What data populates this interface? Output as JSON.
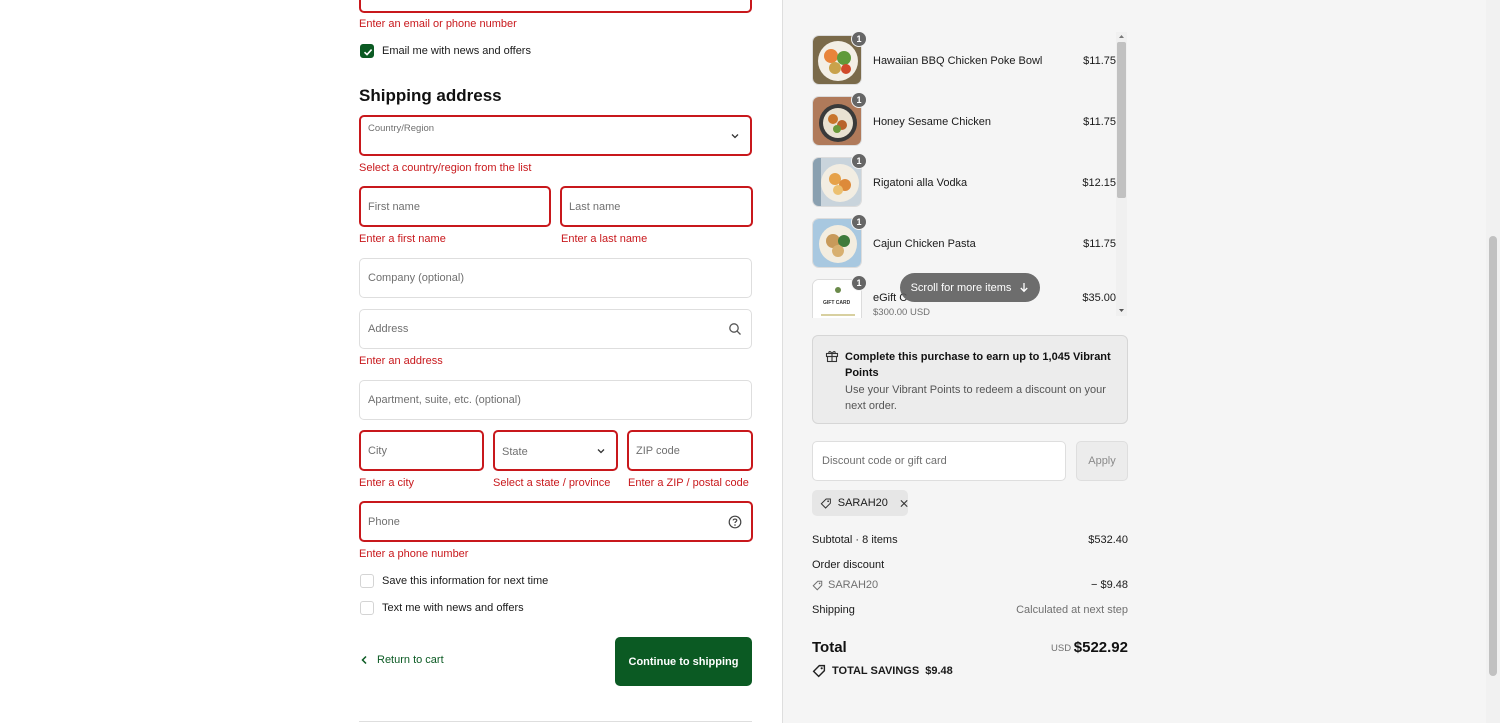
{
  "contact": {
    "email_error": "Enter an email or phone number",
    "email_news_label": "Email me with news and offers",
    "email_news_checked": true
  },
  "shipping": {
    "title": "Shipping address",
    "country_label": "Country/Region",
    "country_error": "Select a country/region from the list",
    "first_name_placeholder": "First name",
    "first_name_error": "Enter a first name",
    "last_name_placeholder": "Last name",
    "last_name_error": "Enter a last name",
    "company_placeholder": "Company (optional)",
    "address_placeholder": "Address",
    "address_error": "Enter an address",
    "apartment_placeholder": "Apartment, suite, etc. (optional)",
    "city_placeholder": "City",
    "city_error": "Enter a city",
    "state_placeholder": "State",
    "state_error": "Select a state / province",
    "zip_placeholder": "ZIP code",
    "zip_error": "Enter a ZIP / postal code",
    "phone_placeholder": "Phone",
    "phone_error": "Enter a phone number",
    "save_info_label": "Save this information for next time",
    "text_news_label": "Text me with news and offers"
  },
  "actions": {
    "return_label": "Return to cart",
    "continue_label": "Continue to shipping"
  },
  "cart": {
    "items": [
      {
        "name": "Hawaiian BBQ Chicken Poke Bowl",
        "price": "$11.75",
        "qty": "1"
      },
      {
        "name": "Honey Sesame Chicken",
        "price": "$11.75",
        "qty": "1"
      },
      {
        "name": "Rigatoni alla Vodka",
        "price": "$12.15",
        "qty": "1"
      },
      {
        "name": "Cajun Chicken Pasta",
        "price": "$11.75",
        "qty": "1"
      },
      {
        "name": "eGift C",
        "sub": "$300.00 USD",
        "price": "$35.00",
        "qty": "1",
        "thumb_text": "GIFT CARD"
      }
    ],
    "scroll_hint": "Scroll for more items"
  },
  "points": {
    "title": "Complete this purchase to earn up to 1,045 Vibrant Points",
    "desc": "Use your Vibrant Points to redeem a discount on your next order."
  },
  "discount": {
    "placeholder": "Discount code or gift card",
    "apply_label": "Apply",
    "applied_code": "SARAH20"
  },
  "summary": {
    "subtotal_label": "Subtotal · 8 items",
    "subtotal_value": "$532.40",
    "order_discount_label": "Order discount",
    "discount_code": "SARAH20",
    "discount_value": "− $9.48",
    "shipping_label": "Shipping",
    "shipping_value": "Calculated at next step",
    "total_label": "Total",
    "currency": "USD",
    "total_value": "$522.92",
    "savings_label": "TOTAL SAVINGS",
    "savings_value": "$9.48"
  },
  "colors": {
    "accent": "#0b5a23",
    "error": "#c8181c",
    "sidebar_bg": "#f5f5f5"
  }
}
